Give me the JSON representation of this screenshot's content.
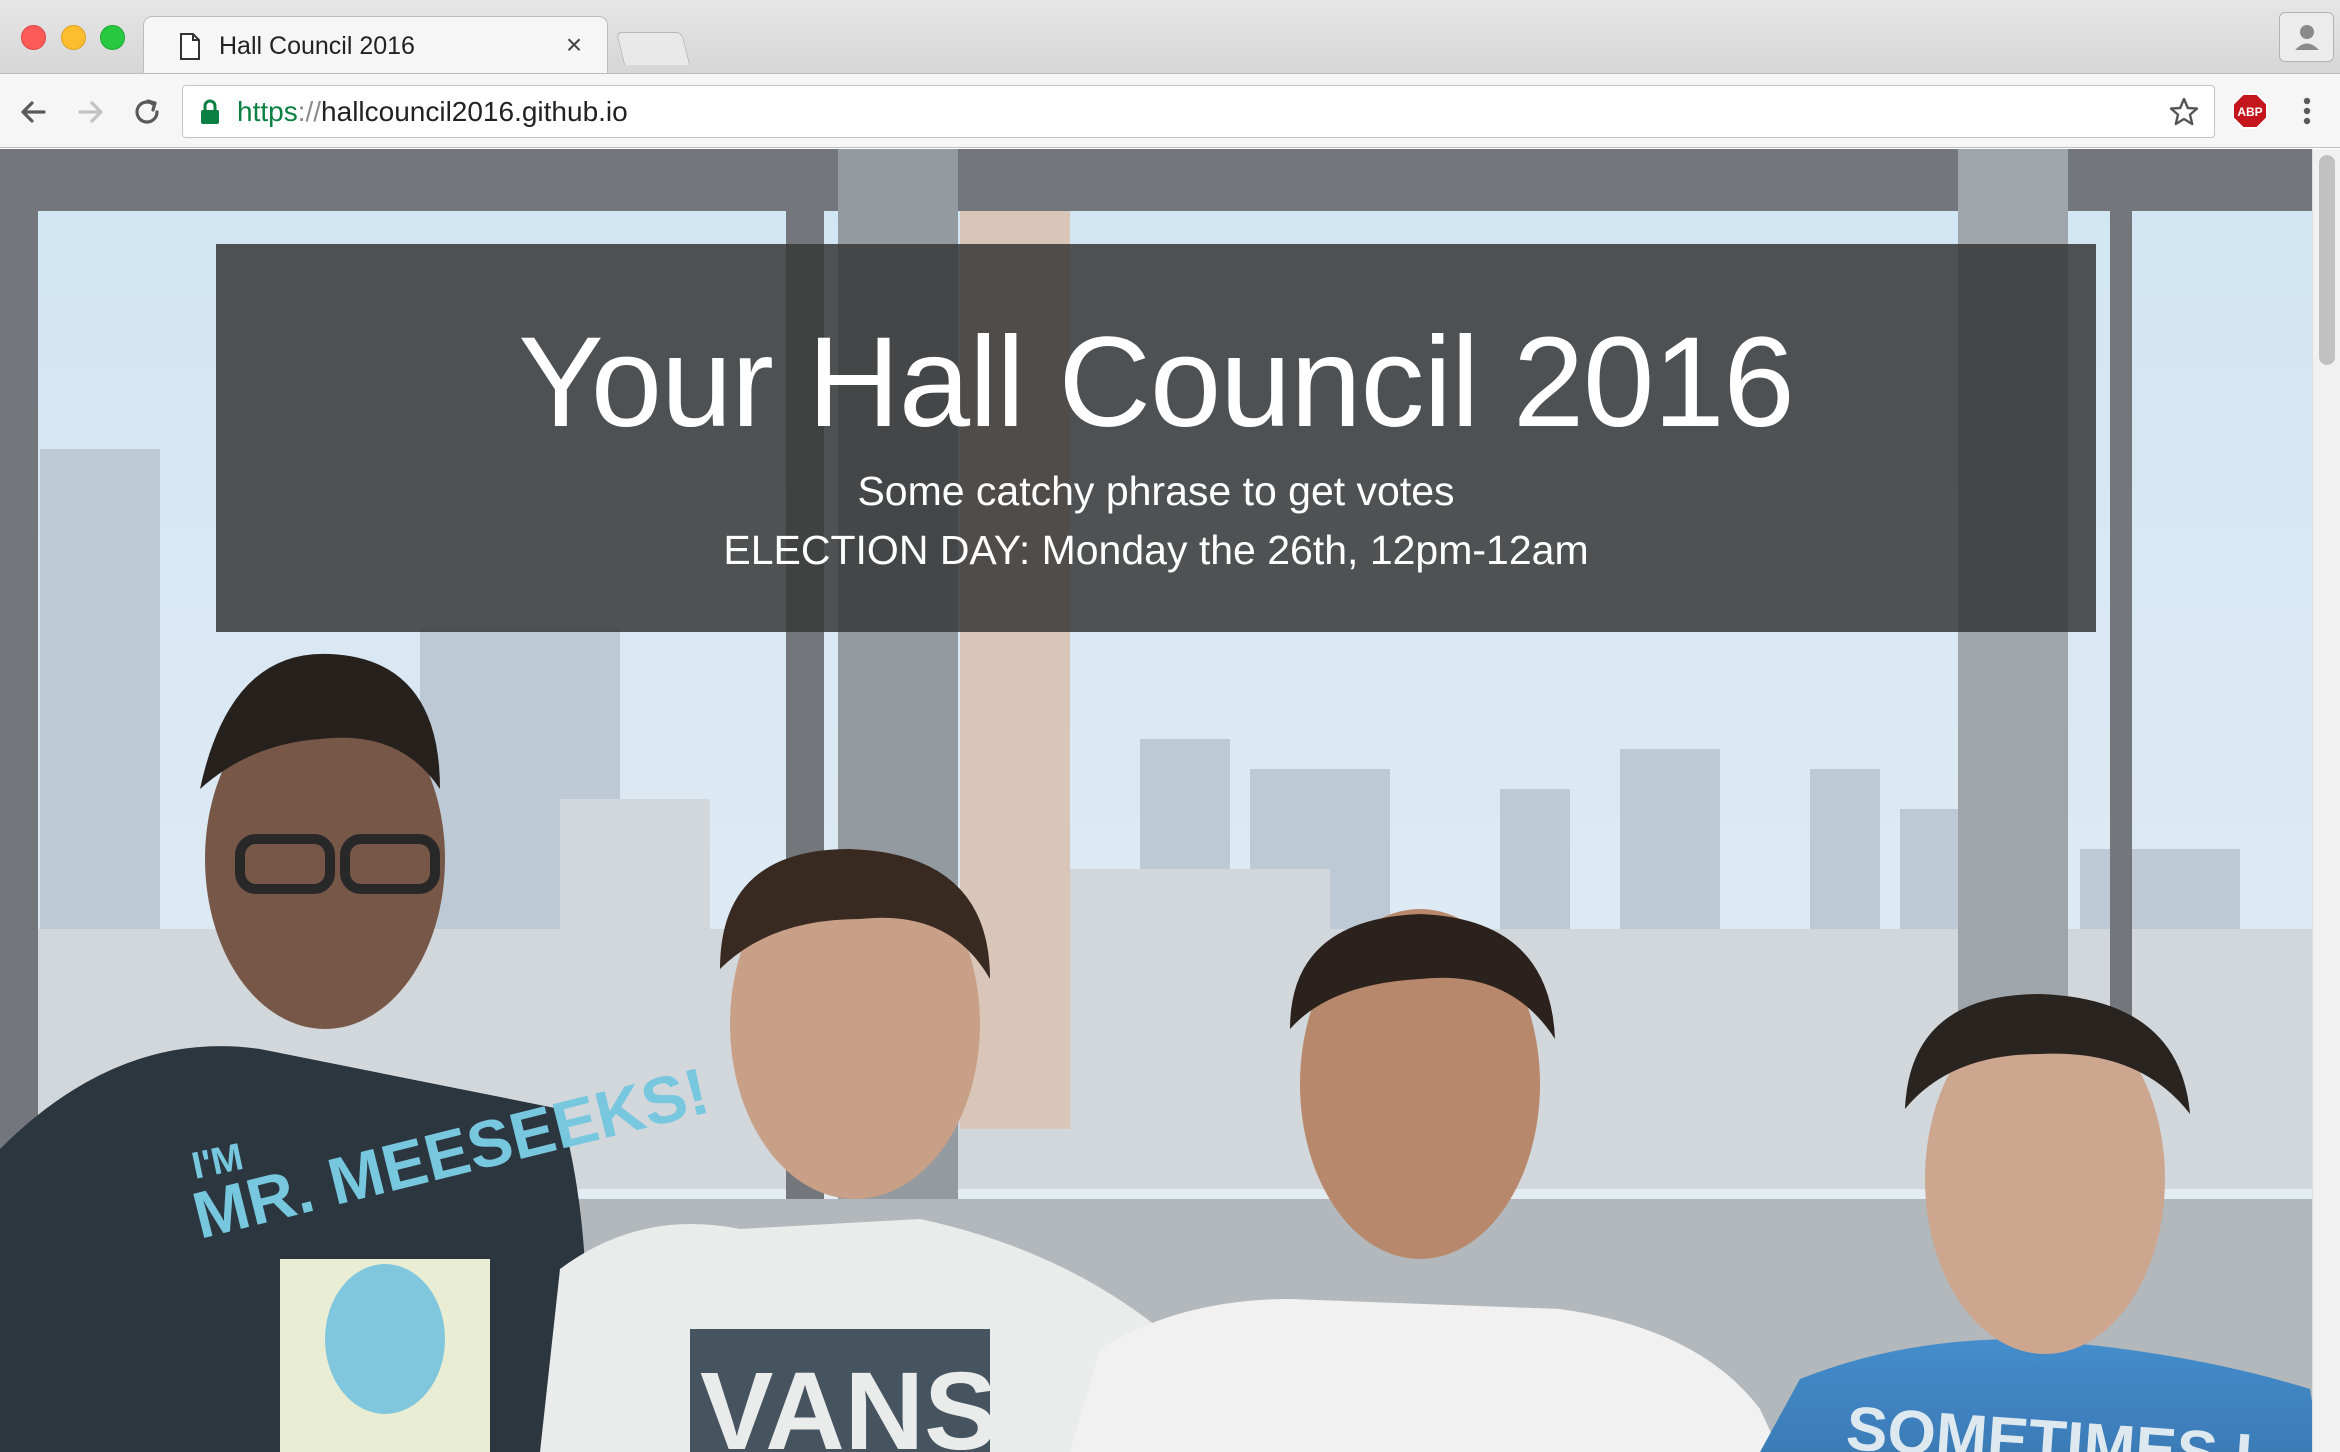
{
  "browser": {
    "tab_title": "Hall Council 2016",
    "tab_close": "×",
    "url_scheme": "https",
    "url_sep": "://",
    "url_host": "hallcouncil2016.github.io",
    "abp_label": "ABP"
  },
  "hero": {
    "title": "Your Hall Council 2016",
    "subtitle": "Some catchy phrase to get votes",
    "election_info": "ELECTION DAY: Monday the 26th, 12pm-12am",
    "photo_shirt_text_1": "I'M",
    "photo_shirt_text_2": "MR. MEESEEKS!",
    "photo_shirt_text_3": "VANS",
    "photo_shirt_text_4": "SOMETIMES I"
  },
  "colors": {
    "secure_green": "#0b8043",
    "jumbotron_bg": "rgba(56,56,56,0.86)",
    "abp_red": "#c4161c"
  }
}
